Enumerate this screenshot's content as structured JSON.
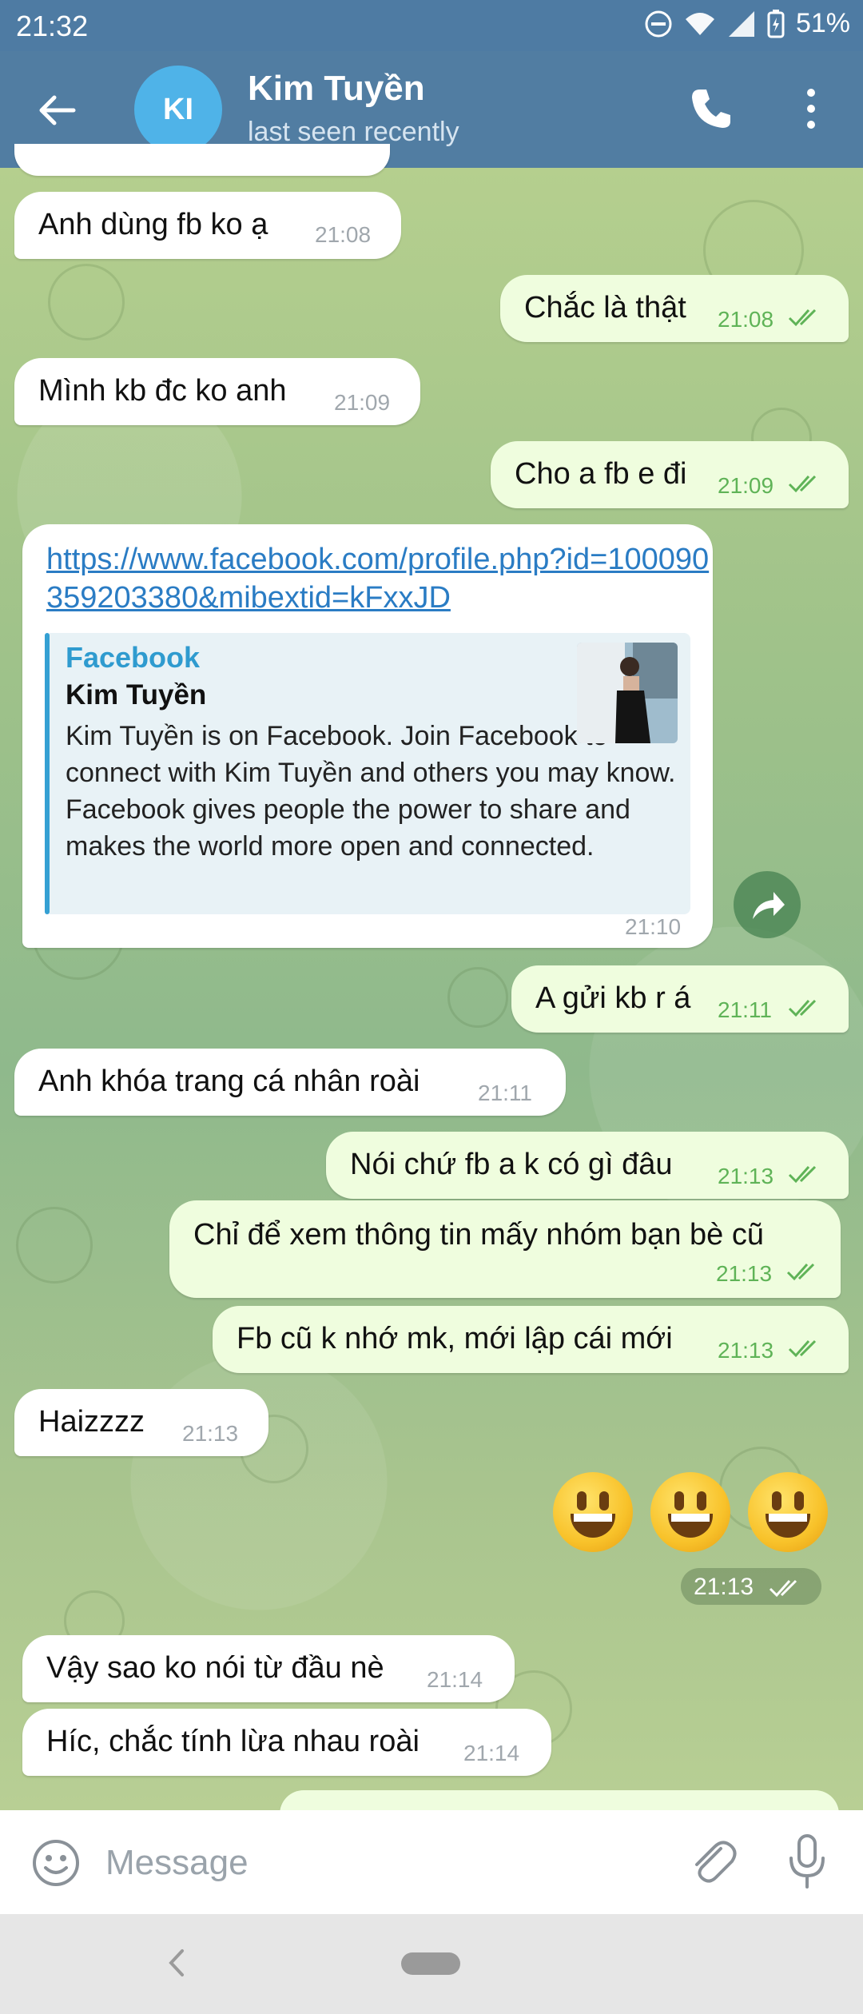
{
  "status_bar": {
    "time": "21:32",
    "battery": "51%"
  },
  "header": {
    "back_label": "←",
    "avatar_initials": "KI",
    "name": "Kim Tuyền",
    "status": "last seen recently"
  },
  "messages": [
    {
      "dir": "in",
      "text": "Anh dùng fb ko ạ",
      "time": "21:08"
    },
    {
      "dir": "out",
      "text": "Chắc là thật",
      "time": "21:08"
    },
    {
      "dir": "in",
      "text": "Mình kb đc ko anh",
      "time": "21:09"
    },
    {
      "dir": "out",
      "text": "Cho a fb e đi",
      "time": "21:09"
    },
    {
      "dir": "out",
      "text": "A gửi kb r á",
      "time": "21:11"
    },
    {
      "dir": "in",
      "text": "Anh khóa trang cá nhân roài",
      "time": "21:11"
    },
    {
      "dir": "out",
      "text": "Nói chứ fb a k có gì đâu",
      "time": "21:13"
    },
    {
      "dir": "out",
      "text": "Chỉ để xem thông tin mấy nhóm bạn bè cũ",
      "time": "21:13"
    },
    {
      "dir": "out",
      "text": "Fb cũ k nhớ mk, mới lập cái mới",
      "time": "21:13"
    },
    {
      "dir": "in",
      "text": "Haizzzz",
      "time": "21:13"
    },
    {
      "dir": "in",
      "text": "Vậy sao ko nói từ đầu nè",
      "time": "21:14"
    },
    {
      "dir": "in",
      "text": "Híc, chắc tính lừa nhau roài",
      "time": "21:14"
    }
  ],
  "link_message": {
    "url": "https://www.facebook.com/profile.php?id=100090359203380&mibextid=kFxxJD",
    "preview_site": "Facebook",
    "preview_title": "Kim Tuyền",
    "preview_desc": "Kim Tuyền is on Facebook. Join Facebook to connect with Kim Tuyền and others you may know. Facebook gives people the power to share and makes the world more open and connected.",
    "time": "21:10"
  },
  "emoji_message": {
    "emojis": [
      "😃",
      "😃",
      "😃"
    ],
    "time": "21:13"
  },
  "input": {
    "placeholder": "Message"
  },
  "colors": {
    "header": "#517da2",
    "outgoing": "#effdde",
    "incoming": "#ffffff",
    "check": "#5fb357"
  }
}
